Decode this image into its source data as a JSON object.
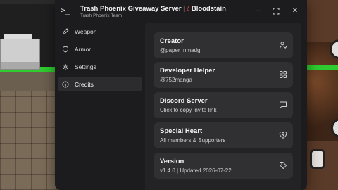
{
  "window": {
    "title": "Trash Phoenix Giveaway Server | ",
    "title_suffix": "Bloodstain",
    "title_icon": "blood-drop-icon",
    "subtitle": "Trash Phoenix Team",
    "app_icon": ">_",
    "controls": {
      "minimize": "–",
      "maximize": "⛶",
      "close": "✕"
    }
  },
  "sidebar": {
    "items": [
      {
        "label": "Weapon",
        "icon": "pencil-icon",
        "active": false
      },
      {
        "label": "Armor",
        "icon": "shield-icon",
        "active": false
      },
      {
        "label": "Settings",
        "icon": "gear-icon",
        "active": false
      },
      {
        "label": "Credits",
        "icon": "info-icon",
        "active": true
      }
    ]
  },
  "credits": [
    {
      "title": "Creator",
      "subtitle": "@paper_nmadg",
      "icon": "user-check-icon"
    },
    {
      "title": "Developer Helper",
      "subtitle": "@752manga",
      "icon": "grid-icon"
    },
    {
      "title": "Discord Server",
      "subtitle": "Click to copy invite link",
      "icon": "message-icon"
    },
    {
      "title": "Special Heart",
      "subtitle": "All members & Supporters",
      "icon": "heart-icon"
    },
    {
      "title": "Version",
      "subtitle": "v1.4.0 | Updated 2026-07-22",
      "icon": "tag-icon"
    }
  ],
  "colors": {
    "accent_drop": "#e23b3b",
    "highlight": "#3f8cff"
  }
}
